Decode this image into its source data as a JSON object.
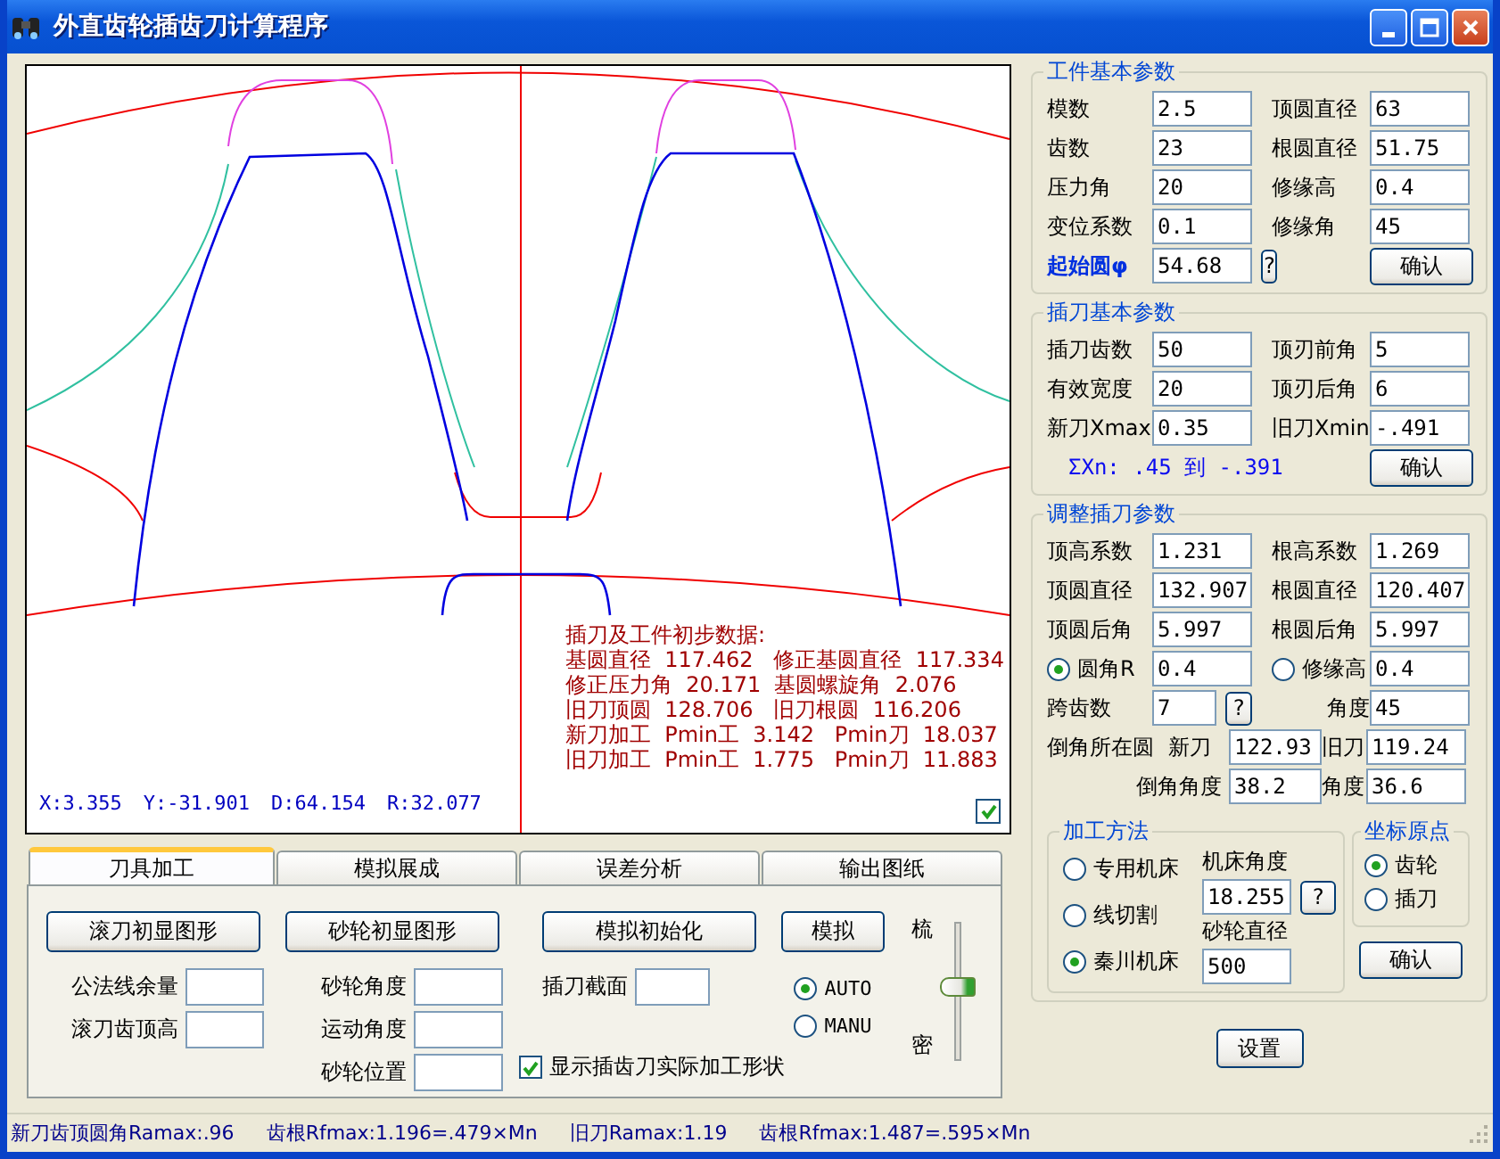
{
  "window": {
    "title": "外直齿轮插齿刀计算程序"
  },
  "canvas": {
    "info_title": "插刀及工件初步数据:",
    "info_lines": [
      "基圆直径  117.462   修正基圆直径  117.334",
      "修正压力角  20.171  基圆螺旋角  2.076",
      "旧刀顶圆  128.706   旧刀根圆  116.206",
      "新刀加工  Pmin工  3.142   Pmin刀  18.037",
      "旧刀加工  Pmin工  1.775   Pmin刀  11.883"
    ],
    "readouts": [
      "X:3.355",
      "Y:-31.901",
      "D:64.154",
      "R:32.077"
    ],
    "toggle_checked": true
  },
  "tabs": [
    {
      "label": "刀具加工",
      "selected": true
    },
    {
      "label": "模拟展成",
      "selected": false
    },
    {
      "label": "误差分析",
      "selected": false
    },
    {
      "label": "输出图纸",
      "selected": false
    }
  ],
  "tool_panel": {
    "columns": [
      {
        "button": "滚刀初显图形",
        "fields": [
          {
            "label": "公法线余量"
          },
          {
            "label": "滚刀齿顶高"
          }
        ]
      },
      {
        "button": "砂轮初显图形",
        "fields": [
          {
            "label": "砂轮角度"
          },
          {
            "label": "运动角度"
          },
          {
            "label": "砂轮位置"
          }
        ]
      },
      {
        "button": "模拟初始化",
        "fields": [
          {
            "label": "插刀截面"
          }
        ]
      }
    ],
    "simulate_button": "模拟",
    "modes": [
      {
        "label": "AUTO",
        "selected": true
      },
      {
        "label": "MANU",
        "selected": false
      }
    ],
    "density_slider": {
      "top_label": "梳",
      "bottom_label": "密",
      "level": 0.55
    },
    "show_shape": {
      "label": "显示插齿刀实际加工形状",
      "checked": true
    }
  },
  "workpiece": {
    "title": "工件基本参数",
    "rows": [
      [
        {
          "kind": "label",
          "text": "模数"
        },
        {
          "kind": "field",
          "value": "2.5"
        },
        {
          "kind": "label",
          "text": "顶圆直径"
        },
        {
          "kind": "field",
          "value": "63"
        }
      ],
      [
        {
          "kind": "label",
          "text": "齿数"
        },
        {
          "kind": "field",
          "value": "23"
        },
        {
          "kind": "label",
          "text": "根圆直径"
        },
        {
          "kind": "field",
          "value": "51.75"
        }
      ],
      [
        {
          "kind": "label",
          "text": "压力角"
        },
        {
          "kind": "field",
          "value": "20"
        },
        {
          "kind": "label",
          "text": "修缘高"
        },
        {
          "kind": "field",
          "value": "0.4"
        }
      ],
      [
        {
          "kind": "label",
          "text": "变位系数"
        },
        {
          "kind": "field",
          "value": "0.1"
        },
        {
          "kind": "label",
          "text": "修缘角"
        },
        {
          "kind": "field",
          "value": "45"
        }
      ],
      [
        {
          "kind": "label_strong",
          "text": "起始圆φ"
        },
        {
          "kind": "field",
          "value": "54.68",
          "button": "?"
        },
        {
          "kind": "button",
          "text": "确认"
        }
      ]
    ]
  },
  "cutter": {
    "title": "插刀基本参数",
    "rows": [
      [
        {
          "kind": "label",
          "text": "插刀齿数"
        },
        {
          "kind": "field",
          "value": "50"
        },
        {
          "kind": "label",
          "text": "顶刃前角"
        },
        {
          "kind": "field",
          "value": "5"
        }
      ],
      [
        {
          "kind": "label",
          "text": "有效宽度"
        },
        {
          "kind": "field",
          "value": "20"
        },
        {
          "kind": "label",
          "text": "顶刃后角"
        },
        {
          "kind": "field",
          "value": "6"
        }
      ],
      [
        {
          "kind": "label",
          "text": "新刀Xmax"
        },
        {
          "kind": "field",
          "value": "0.35"
        },
        {
          "kind": "label",
          "text": "旧刀Xmin"
        },
        {
          "kind": "field",
          "value": "-.491"
        }
      ],
      [
        {
          "kind": "note",
          "text": "ΣXn: .45 到 -.391"
        },
        {
          "kind": "button",
          "text": "确认"
        }
      ]
    ]
  },
  "adjust": {
    "title": "调整插刀参数",
    "rows": [
      [
        {
          "kind": "label",
          "text": "顶高系数"
        },
        {
          "kind": "field",
          "value": "1.231"
        },
        {
          "kind": "label",
          "text": "根高系数"
        },
        {
          "kind": "field",
          "value": "1.269"
        }
      ],
      [
        {
          "kind": "label",
          "text": "顶圆直径"
        },
        {
          "kind": "field",
          "value": "132.907"
        },
        {
          "kind": "label",
          "text": "根圆直径"
        },
        {
          "kind": "field",
          "value": "120.407"
        }
      ],
      [
        {
          "kind": "label",
          "text": "顶圆后角"
        },
        {
          "kind": "field",
          "value": "5.997"
        },
        {
          "kind": "label",
          "text": "根圆后角"
        },
        {
          "kind": "field",
          "value": "5.997"
        }
      ],
      [
        {
          "kind": "radio",
          "text": "圆角R",
          "selected": true
        },
        {
          "kind": "field",
          "value": "0.4"
        },
        {
          "kind": "radio",
          "text": "修缘高",
          "selected": false
        },
        {
          "kind": "field",
          "value": "0.4"
        }
      ],
      [
        {
          "kind": "label",
          "text": "跨齿数"
        },
        {
          "kind": "short_field",
          "value": "7",
          "button": "?"
        },
        {
          "kind": "label_right",
          "text": "角度"
        },
        {
          "kind": "field",
          "value": "45"
        }
      ]
    ],
    "chamfer_rows": [
      [
        {
          "kind": "label",
          "text": "倒角所在圆"
        },
        {
          "kind": "label",
          "text": "新刀"
        },
        {
          "kind": "field",
          "value": "122.93"
        },
        {
          "kind": "label",
          "text": "旧刀"
        },
        {
          "kind": "field",
          "value": "119.24"
        }
      ],
      [
        {
          "kind": "label_wide",
          "text": "倒角角度"
        },
        {
          "kind": "field",
          "value": "38.2"
        },
        {
          "kind": "label",
          "text": "角度"
        },
        {
          "kind": "field",
          "value": "36.6"
        }
      ]
    ],
    "method": {
      "title": "加工方法",
      "options": [
        {
          "label": "专用机床",
          "selected": false
        },
        {
          "label": "线切割",
          "selected": false
        },
        {
          "label": "秦川机床",
          "selected": true
        }
      ],
      "machine_angle_label": "机床角度",
      "machine_angle": "18.255",
      "help_button": "?",
      "wheel_diameter_label": "砂轮直径",
      "wheel_diameter": "500"
    },
    "origin": {
      "title": "坐标原点",
      "options": [
        {
          "label": "齿轮",
          "selected": true
        },
        {
          "label": "插刀",
          "selected": false
        }
      ]
    },
    "confirm_button": "确认"
  },
  "settings_button": "设置",
  "status_bar": [
    "新刀齿顶圆角Ramax:.96",
    "齿根Rfmax:1.196=.479×Mn",
    "旧刀Ramax:1.19",
    "齿根Rfmax:1.487=.595×Mn"
  ]
}
